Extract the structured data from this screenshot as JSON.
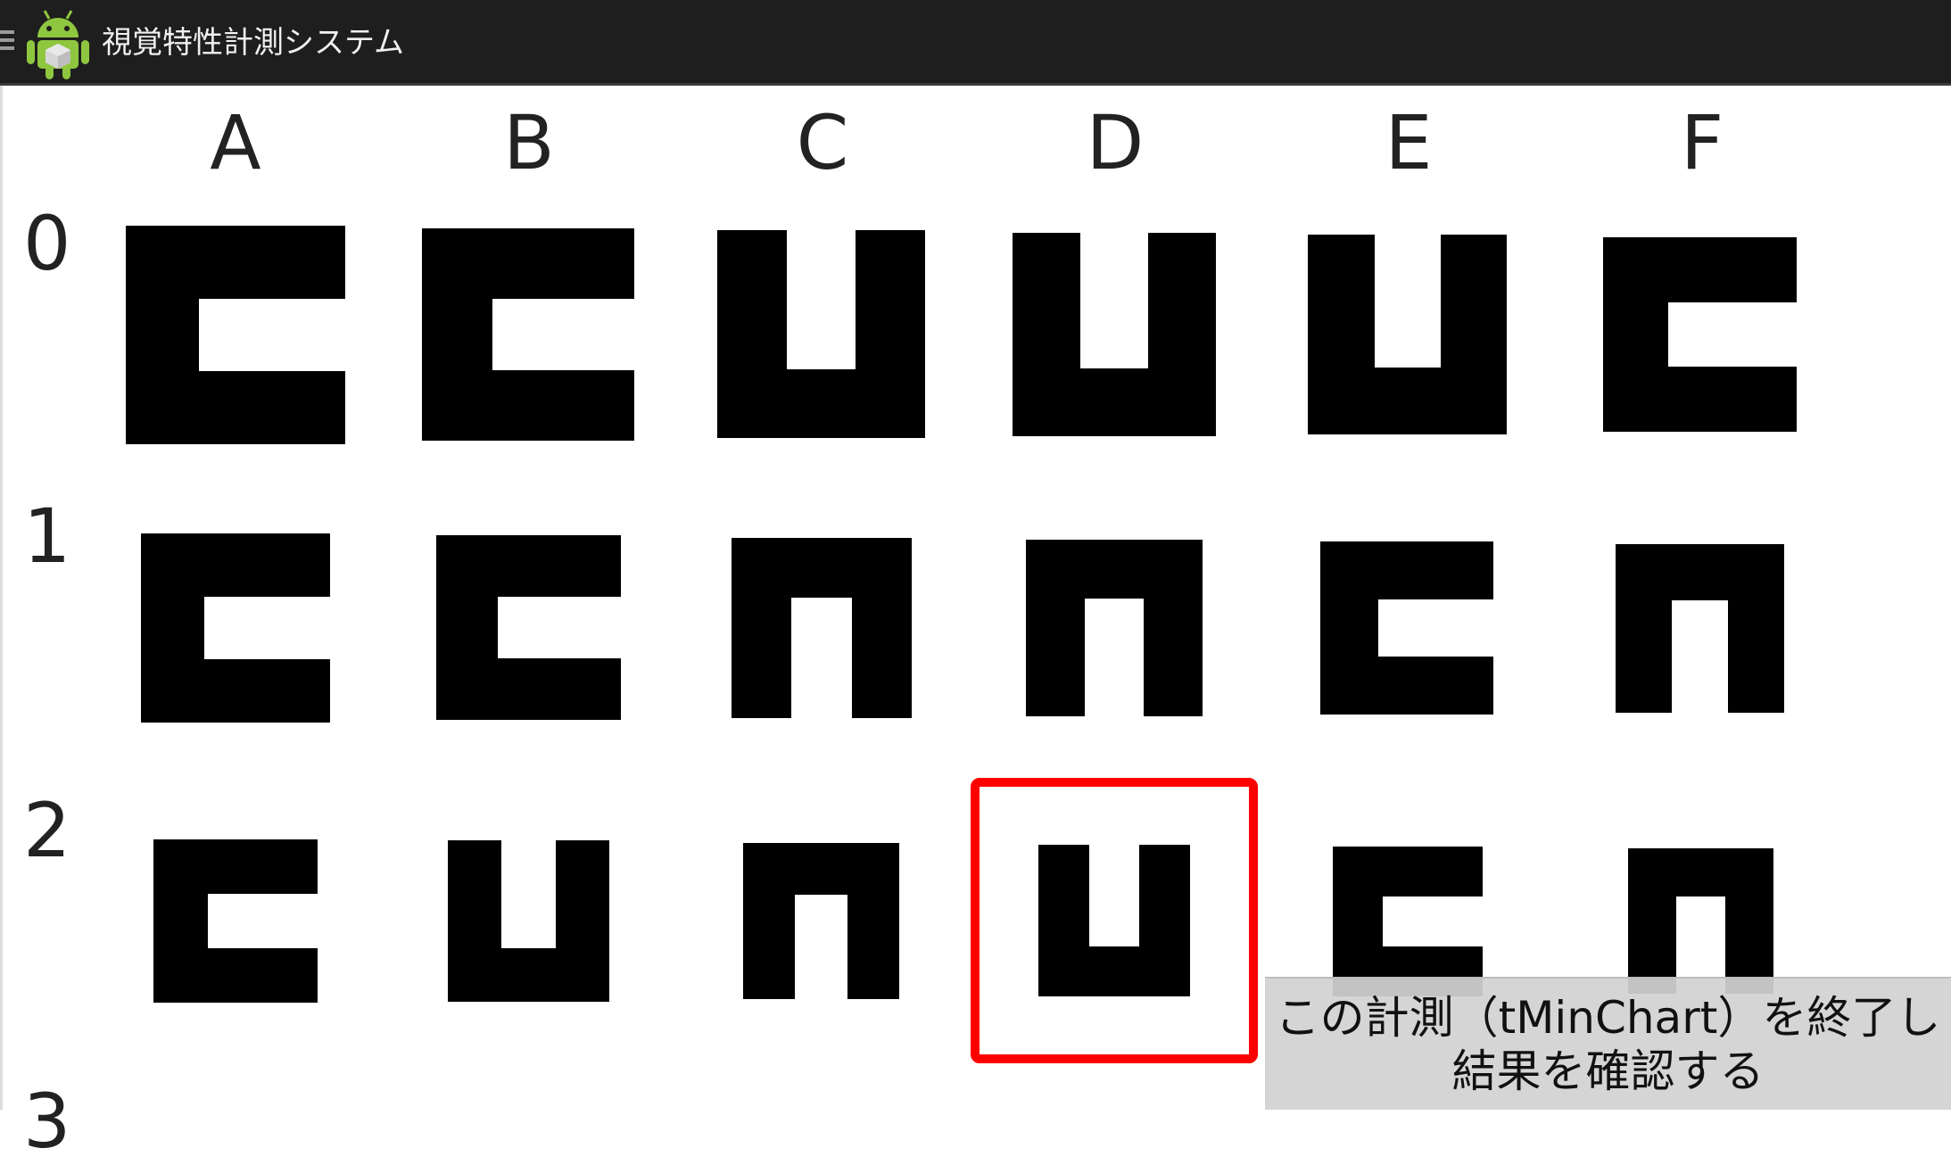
{
  "app": {
    "title": "視覚特性計測システム",
    "icon": "android-icon",
    "menu_icon": "menu-icon"
  },
  "grid": {
    "columns": [
      "A",
      "B",
      "C",
      "D",
      "E",
      "F"
    ],
    "rows": [
      "0",
      "1",
      "2",
      "3"
    ],
    "optotypes": [
      [
        "opening-right",
        "opening-right",
        "opening-top",
        "opening-top",
        "opening-top",
        "opening-right"
      ],
      [
        "opening-right",
        "opening-right",
        "opening-bottom",
        "opening-bottom",
        "opening-right",
        "opening-bottom"
      ],
      [
        "opening-right",
        "opening-top",
        "opening-bottom",
        "opening-top",
        "opening-right",
        "opening-bottom"
      ]
    ],
    "selected": "D2",
    "highlight_color": "#ff0000"
  },
  "finish_button": {
    "line1": "この計測（tMinChart）を終了し",
    "line2": "結果を確認する"
  }
}
